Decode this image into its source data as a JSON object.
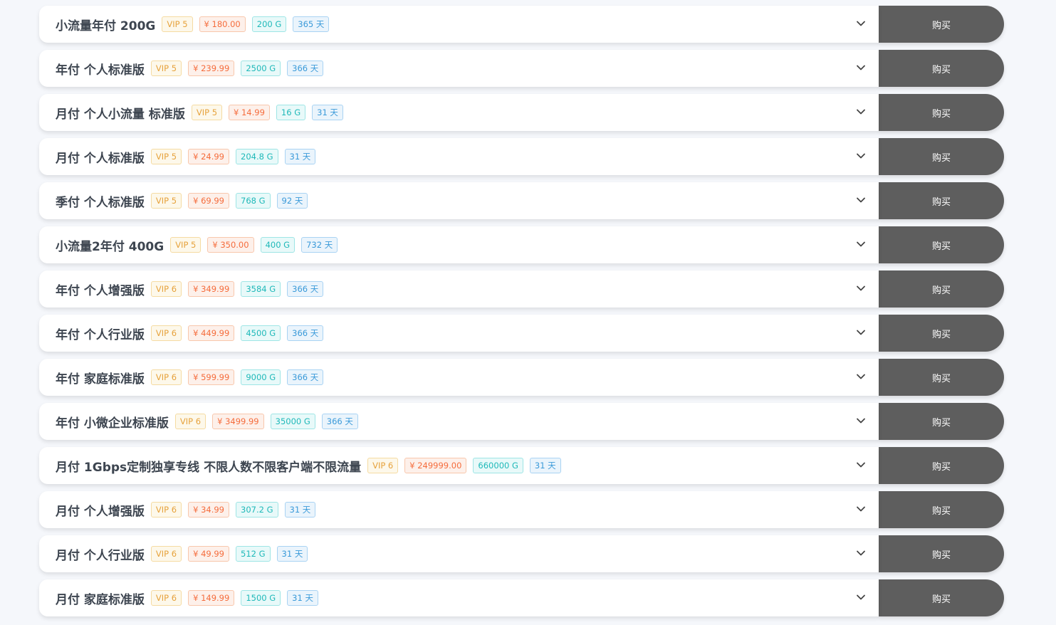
{
  "buy_label": "购买",
  "plans": [
    {
      "title": "小流量年付 200G",
      "vip": "VIP 5",
      "price": "¥ 180.00",
      "traffic": "200 G",
      "days": "365 天"
    },
    {
      "title": "年付 个人标准版",
      "vip": "VIP 5",
      "price": "¥ 239.99",
      "traffic": "2500 G",
      "days": "366 天"
    },
    {
      "title": "月付 个人小流量 标准版",
      "vip": "VIP 5",
      "price": "¥ 14.99",
      "traffic": "16 G",
      "days": "31 天"
    },
    {
      "title": "月付 个人标准版",
      "vip": "VIP 5",
      "price": "¥ 24.99",
      "traffic": "204.8 G",
      "days": "31 天"
    },
    {
      "title": "季付 个人标准版",
      "vip": "VIP 5",
      "price": "¥ 69.99",
      "traffic": "768 G",
      "days": "92 天"
    },
    {
      "title": "小流量2年付 400G",
      "vip": "VIP 5",
      "price": "¥ 350.00",
      "traffic": "400 G",
      "days": "732 天"
    },
    {
      "title": "年付 个人增强版",
      "vip": "VIP 6",
      "price": "¥ 349.99",
      "traffic": "3584 G",
      "days": "366 天"
    },
    {
      "title": "年付 个人行业版",
      "vip": "VIP 6",
      "price": "¥ 449.99",
      "traffic": "4500 G",
      "days": "366 天"
    },
    {
      "title": "年付 家庭标准版",
      "vip": "VIP 6",
      "price": "¥ 599.99",
      "traffic": "9000 G",
      "days": "366 天"
    },
    {
      "title": "年付 小微企业标准版",
      "vip": "VIP 6",
      "price": "¥ 3499.99",
      "traffic": "35000 G",
      "days": "366 天"
    },
    {
      "title": "月付 1Gbps定制独享专线 不限人数不限客户端不限流量",
      "vip": "VIP 6",
      "price": "¥ 249999.00",
      "traffic": "660000 G",
      "days": "31 天"
    },
    {
      "title": "月付 个人增强版",
      "vip": "VIP 6",
      "price": "¥ 34.99",
      "traffic": "307.2 G",
      "days": "31 天"
    },
    {
      "title": "月付 个人行业版",
      "vip": "VIP 6",
      "price": "¥ 49.99",
      "traffic": "512 G",
      "days": "31 天"
    },
    {
      "title": "月付 家庭标准版",
      "vip": "VIP 6",
      "price": "¥ 149.99",
      "traffic": "1500 G",
      "days": "31 天"
    }
  ],
  "colors": {
    "vip": "#e6a23c",
    "price": "#f56c3c",
    "traffic": "#1fb9b9",
    "days": "#3a9ad9",
    "buy_button": "#5e5e5e"
  },
  "icons": {
    "expand": "chevron-down-icon"
  }
}
